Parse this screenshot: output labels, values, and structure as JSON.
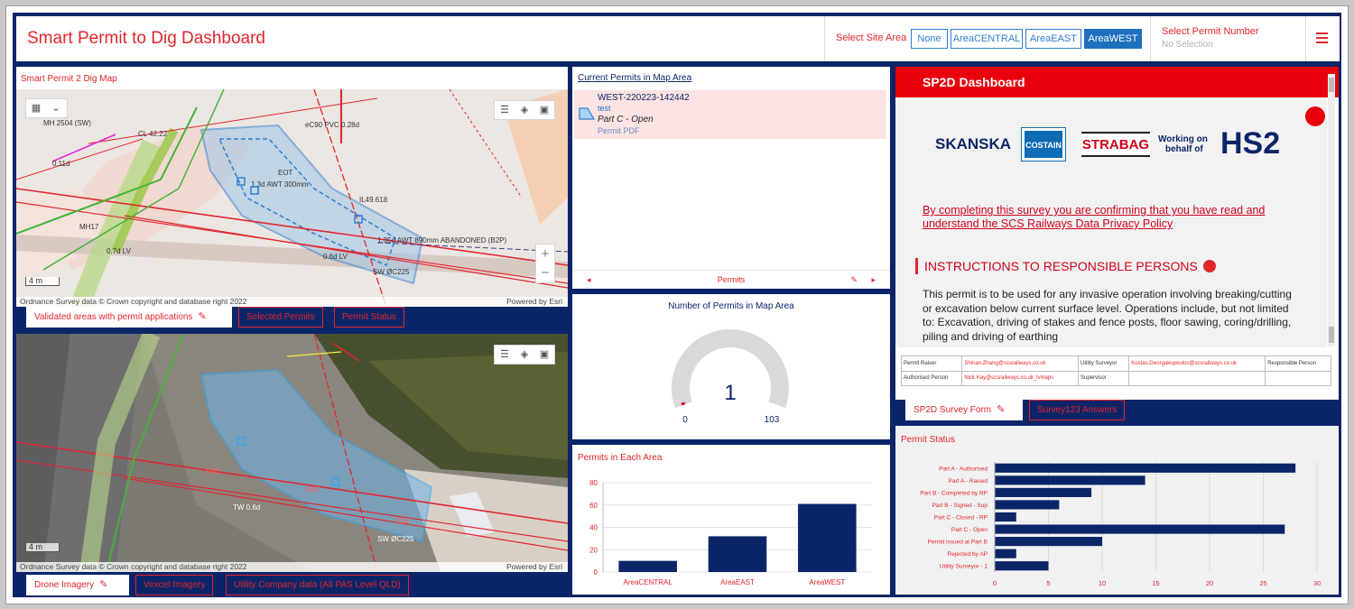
{
  "header": {
    "title": "Smart Permit to Dig Dashboard",
    "site_area_label": "Select Site Area",
    "site_areas": [
      "None",
      "AreaCENTRAL",
      "AreaEAST",
      "AreaWEST"
    ],
    "selected_site_area": "AreaWEST",
    "permit_number_label": "Select Permit Number",
    "permit_number_value": "No Selection"
  },
  "map_panel": {
    "title": "Smart Permit 2 Dig Map",
    "scale": "4 m",
    "attribution": "Ordnance Survey data © Crown copyright and database right 2022",
    "powered": "Powered by Esri",
    "tabs": [
      "Validated areas with permit applications",
      "Selected Permits",
      "Permit Status"
    ]
  },
  "drone_panel": {
    "scale": "4 m",
    "attribution": "Ordnance Survey data © Crown copyright and database right 2022",
    "powered": "Powered by Esri",
    "tabs": [
      "Drone Imagery",
      "Vexcel Imagery",
      "Utility Company data (All PAS Level QLD)"
    ]
  },
  "permits_list": {
    "title": "Current Permits in Map Area",
    "item": {
      "id": "WEST-220223-142442",
      "name": "test",
      "status": "Part C - Open",
      "link": "Permit PDF"
    },
    "footer": "Permits"
  },
  "gauge": {
    "title": "Number of Permits in Map Area",
    "value": 1,
    "min": 0,
    "max": 103,
    "value_text": "1",
    "min_text": "0",
    "max_text": "103"
  },
  "sp2d": {
    "title": "SP2D Dashboard",
    "logos": [
      "SKANSKA",
      "COSTAIN",
      "STRABAG",
      "Working on",
      "behalf of",
      "HS2"
    ],
    "privacy_line1": "By completing this survey you are confirming that you have read and",
    "privacy_line2": "understand the SCS Railways Data Privacy Policy",
    "instructions": "INSTRUCTIONS TO RESPONSIBLE PERSONS",
    "paragraph": "This permit is to be used for any invasive operation involving breaking/cutting or excavation below current surface level. Operations include, but not limited to: Excavation, driving of stakes and fence posts, floor sawing, coring/drilling, piling and driving of earthing",
    "grid": {
      "r1": [
        "Permit Raiser",
        "Shinan.Zhang@scsrailways.co.uk",
        "Utility Surveyor",
        "Kostas.Georgakopoulos@scsrailways.co.uk",
        "Responsible Person"
      ],
      "r2": [
        "Authorised Person",
        "Nick.Kay@scsrailways.co.uk_lvmaps",
        "Supervisor"
      ]
    },
    "tabs": [
      "SP2D Survey Form",
      "Survey123 Answers"
    ]
  },
  "colors": {
    "accent": "#e3262b",
    "navy": "#0b2568",
    "bar": "#0b2568",
    "selected": "#1f6fbf"
  },
  "chart_data": [
    {
      "type": "bar",
      "title": "Permits in Each Area",
      "categories": [
        "AreaCENTRAL",
        "AreaEAST",
        "AreaWEST"
      ],
      "values": [
        10,
        32,
        61
      ],
      "ylim": [
        0,
        80
      ],
      "yticks": [
        0,
        20,
        40,
        60,
        80
      ],
      "grid": true
    },
    {
      "type": "bar",
      "orientation": "horizontal",
      "title": "Permit Status",
      "categories": [
        "Part A - Authorised",
        "Part A - Raised",
        "Part B - Completed by RP",
        "Part B - Signed - Sup",
        "Part C - Closed - RP",
        "Part C - Open",
        "Permit issued at Part B",
        "Rejected by AP",
        "Utility Surveyor - 1"
      ],
      "values": [
        28,
        14,
        9,
        6,
        2,
        27,
        10,
        2,
        5
      ],
      "xlim": [
        0,
        30
      ],
      "xticks": [
        0,
        5,
        10,
        15,
        20,
        25,
        30
      ],
      "grid": true
    }
  ]
}
